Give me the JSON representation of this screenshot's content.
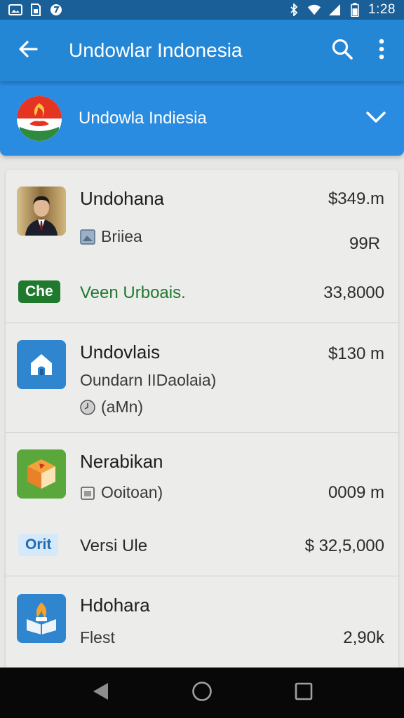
{
  "status": {
    "time": "1:28",
    "left_icons": [
      "image-icon",
      "sim-icon",
      "shield-icon"
    ],
    "right_icons": [
      "bluetooth-icon",
      "wifi-icon",
      "signal-icon",
      "battery-icon"
    ]
  },
  "app_bar": {
    "title": "Undowlar Indonesia",
    "back_icon": "arrow-left-icon",
    "actions": [
      "search-icon",
      "more-vert-icon"
    ]
  },
  "region": {
    "name": "Undowla Indiesia",
    "flag_icon": "flag-badge-icon",
    "chevron_icon": "chevron-down-icon"
  },
  "items": [
    {
      "name": "Undohana",
      "avatar": "person-photo",
      "sub": "Briiea",
      "sub_icon": "image-icon",
      "price": "$349.m",
      "secondary": "99R",
      "tag": "Che",
      "tag_color": "#1f7a2e",
      "tag_text": "Veen Urboais.",
      "tag_value": "33,8000"
    },
    {
      "name": "Undovlais",
      "avatar": "home-app-icon",
      "sub": "Oundarn IIDaolaia)",
      "sub2": "(aMn)",
      "sub2_icon": "clock-icon",
      "price": "$130 m"
    },
    {
      "name": "Nerabikan",
      "avatar": "box-app-icon",
      "sub": "Ooitoan)",
      "sub_icon": "calendar-icon",
      "price": "0009 m",
      "tag": "Orit",
      "tag_color": "#d6e9fa",
      "tag_text": "Versi Ule",
      "tag_value": "$ 32,5,000"
    },
    {
      "name": "Hdohara",
      "avatar": "book-app-icon",
      "sub": "Flest",
      "price": "2,90k"
    }
  ],
  "nav": [
    "back-triangle-icon",
    "home-circle-icon",
    "recents-square-icon"
  ]
}
